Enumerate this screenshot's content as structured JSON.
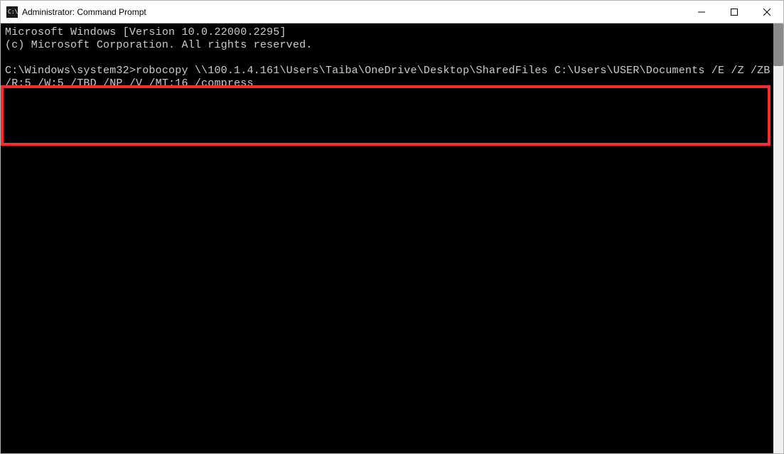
{
  "window": {
    "title": "Administrator: Command Prompt"
  },
  "terminal": {
    "lines": [
      "Microsoft Windows [Version 10.0.22000.2295]",
      "(c) Microsoft Corporation. All rights reserved.",
      "",
      "C:\\Windows\\system32>robocopy \\\\100.1.4.161\\Users\\Taiba\\OneDrive\\Desktop\\SharedFiles C:\\Users\\USER\\Documents /E /Z /ZB /R:5 /W:5 /TBD /NP /V /MT:16 /compress",
      ""
    ],
    "prompt": "C:\\Windows\\system32>",
    "command": "robocopy \\\\100.1.4.161\\Users\\Taiba\\OneDrive\\Desktop\\SharedFiles C:\\Users\\USER\\Documents /E /Z /ZB /R:5 /W:5 /TBD /NP /V /MT:16 /compress",
    "version_line": "Microsoft Windows [Version 10.0.22000.2295]",
    "copyright_line": "(c) Microsoft Corporation. All rights reserved."
  },
  "annotation": {
    "highlight_color": "#ff2b2b"
  }
}
